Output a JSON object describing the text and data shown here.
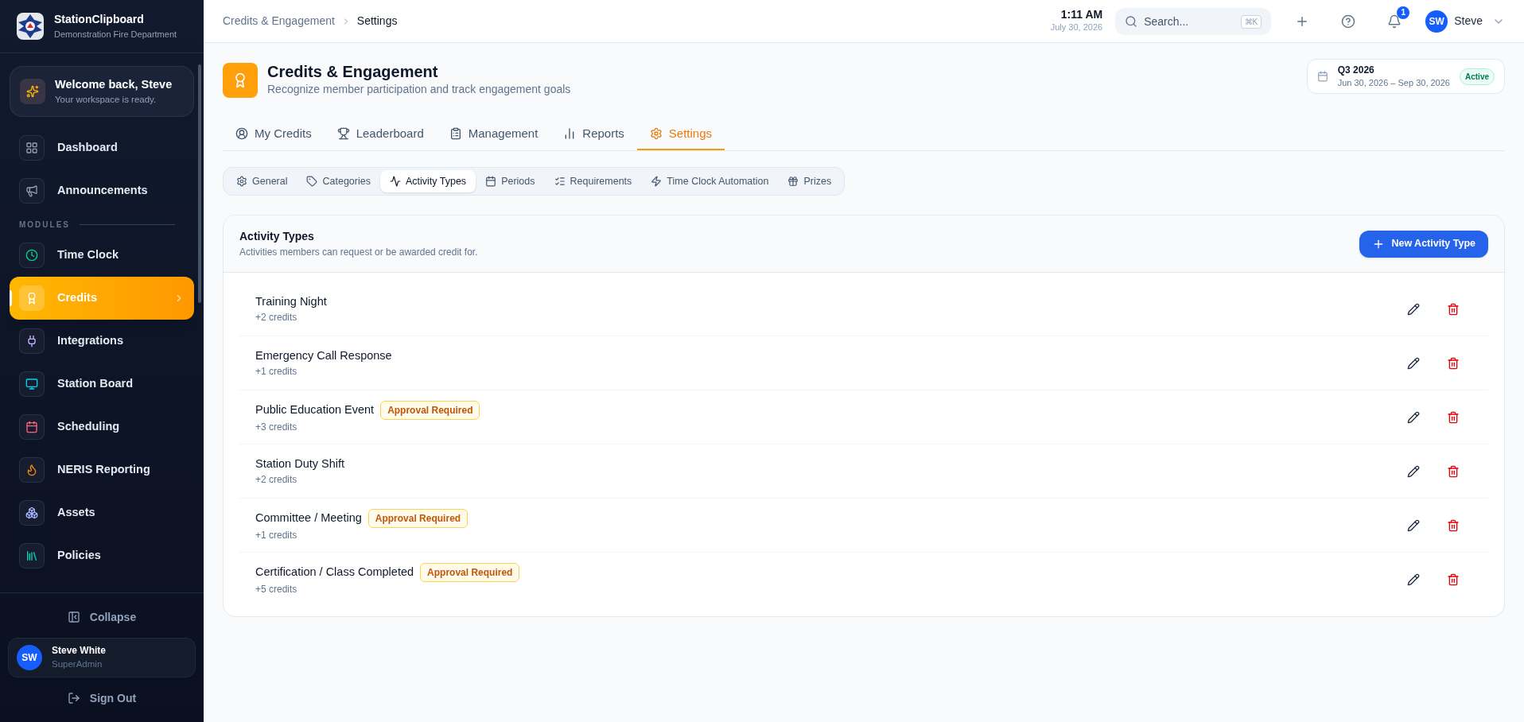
{
  "sidebar": {
    "app_name": "StationClipboard",
    "org_name": "Demonstration Fire Department",
    "welcome": {
      "title": "Welcome back, Steve",
      "subtitle": "Your workspace is ready."
    },
    "top_items": [
      {
        "label": "Dashboard",
        "selected": false
      },
      {
        "label": "Announcements",
        "selected": false
      }
    ],
    "section_label": "MODULES",
    "module_items": [
      {
        "label": "Time Clock",
        "selected": false
      },
      {
        "label": "Credits",
        "selected": true
      },
      {
        "label": "Integrations",
        "selected": false
      },
      {
        "label": "Station Board",
        "selected": false
      },
      {
        "label": "Scheduling",
        "selected": false
      },
      {
        "label": "NERIS Reporting",
        "selected": false
      },
      {
        "label": "Assets",
        "selected": false
      },
      {
        "label": "Policies",
        "selected": false
      }
    ],
    "collapse": "Collapse",
    "user": {
      "initials": "SW",
      "name": "Steve White",
      "role": "SuperAdmin"
    },
    "sign_out": "Sign Out"
  },
  "header": {
    "breadcrumbs": [
      "Credits & Engagement",
      "Settings"
    ],
    "time": "1:11 AM",
    "date": "July 30, 2026",
    "search": {
      "placeholder": "Search...",
      "shortcut": "⌘K"
    },
    "notification_count": "1",
    "user_initials": "SW",
    "user_name": "Steve"
  },
  "page": {
    "title": "Credits & Engagement",
    "subtitle": "Recognize member participation and track engagement goals",
    "period": {
      "name": "Q3 2026",
      "range": "Jun 30, 2026 – Sep 30, 2026",
      "status": "Active"
    },
    "tabs": [
      {
        "label": "My Credits",
        "selected": false
      },
      {
        "label": "Leaderboard",
        "selected": false
      },
      {
        "label": "Management",
        "selected": false
      },
      {
        "label": "Reports",
        "selected": false
      },
      {
        "label": "Settings",
        "selected": true
      }
    ],
    "subtabs": [
      {
        "label": "General",
        "selected": false
      },
      {
        "label": "Categories",
        "selected": false
      },
      {
        "label": "Activity Types",
        "selected": true
      },
      {
        "label": "Periods",
        "selected": false
      },
      {
        "label": "Requirements",
        "selected": false
      },
      {
        "label": "Time Clock Automation",
        "selected": false
      },
      {
        "label": "Prizes",
        "selected": false
      }
    ],
    "card": {
      "title": "Activity Types",
      "subtitle": "Activities members can request or be awarded credit for.",
      "new_button": "New Activity Type",
      "rows": [
        {
          "name": "Training Night",
          "credits": "+2 credits"
        },
        {
          "name": "Emergency Call Response",
          "credits": "+1 credits"
        },
        {
          "name": "Public Education Event",
          "credits": "+3 credits",
          "badge": "Approval Required"
        },
        {
          "name": "Station Duty Shift",
          "credits": "+2 credits"
        },
        {
          "name": "Committee / Meeting",
          "credits": "+1 credits",
          "badge": "Approval Required"
        },
        {
          "name": "Certification / Class Completed",
          "credits": "+5 credits",
          "badge": "Approval Required"
        }
      ]
    }
  }
}
